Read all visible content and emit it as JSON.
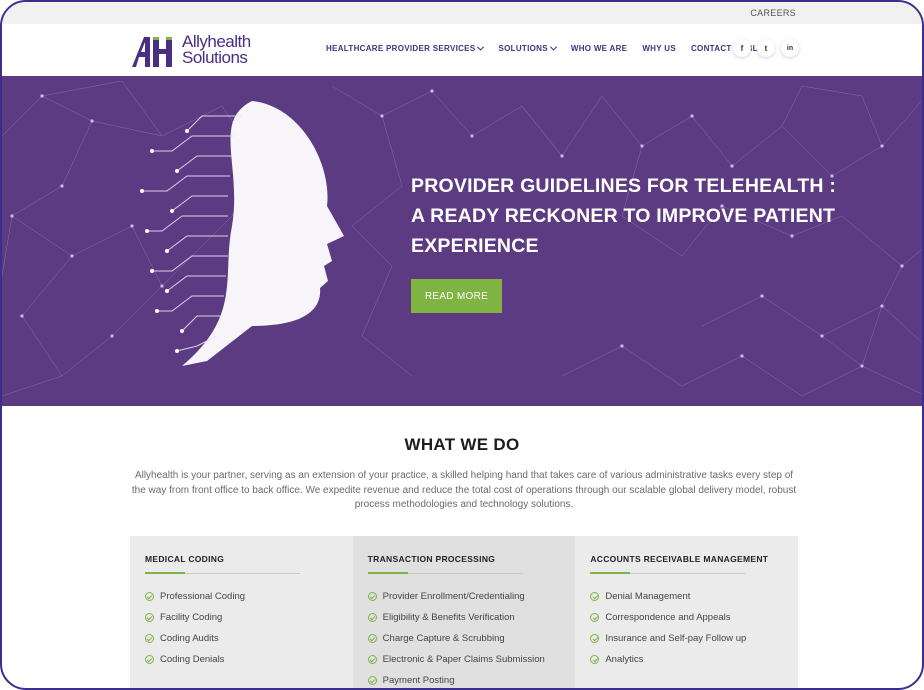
{
  "topbar": {
    "careers": "CAREERS"
  },
  "logo": {
    "mark": "AH",
    "line1": "Allyhealth",
    "line2": "Solutions"
  },
  "nav": [
    {
      "label": "HEALTHCARE PROVIDER SERVICES",
      "dropdown": true
    },
    {
      "label": "SOLUTIONS",
      "dropdown": true
    },
    {
      "label": "WHO WE ARE",
      "dropdown": false
    },
    {
      "label": "WHY US",
      "dropdown": false
    },
    {
      "label": "CONTACT",
      "dropdown": false
    },
    {
      "label": "BLOG",
      "dropdown": false
    }
  ],
  "social": {
    "facebook": "f",
    "twitter": "t",
    "linkedin": "in"
  },
  "hero": {
    "title_line1": "PROVIDER GUIDELINES FOR TELEHEALTH :",
    "title_line2": "A READY RECKONER TO IMPROVE PATIENT",
    "title_line3": "EXPERIENCE",
    "cta": "READ MORE"
  },
  "what_we_do": {
    "title": "WHAT WE DO",
    "description": "Allyhealth is your partner, serving as an extension of your practice, a skilled helping hand that takes care of various administrative tasks every step of the way from front office to back office. We expedite revenue and reduce the total cost of operations through our scalable global delivery model, robust process methodologies and technology solutions."
  },
  "cards": [
    {
      "title": "MEDICAL CODING",
      "items": [
        "Professional Coding",
        "Facility Coding",
        "Coding Audits",
        "Coding Denials"
      ]
    },
    {
      "title": "TRANSACTION PROCESSING",
      "items": [
        "Provider Enrollment/Credentialing",
        "Eligibility & Benefits Verification",
        "Charge Capture & Scrubbing",
        "Electronic & Paper Claims Submission",
        "Payment Posting"
      ]
    },
    {
      "title": "ACCOUNTS RECEIVABLE MANAGEMENT",
      "items": [
        "Denial Management",
        "Correspondence and Appeals",
        "Insurance and Self-pay Follow up",
        "Analytics"
      ]
    }
  ],
  "colors": {
    "brand_purple": "#5c3b82",
    "accent_green": "#7fb342",
    "frame_border": "#3a2f8f"
  },
  "icons": [
    "facebook-icon",
    "twitter-icon",
    "linkedin-icon",
    "chevron-down-icon",
    "check-circle-icon",
    "ai-face-illustration"
  ]
}
